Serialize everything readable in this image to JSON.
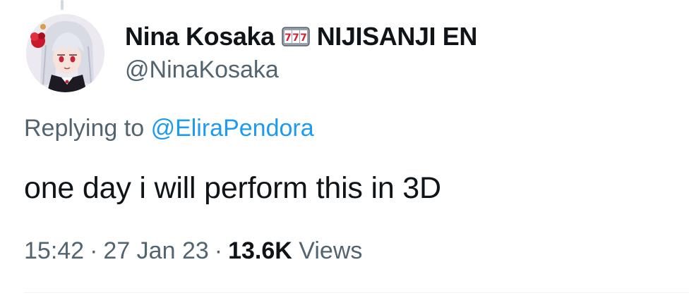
{
  "author": {
    "display_name": "Nina Kosaka",
    "badge_emoji": "slot-machine-icon",
    "affiliation": "NIJISANJI EN",
    "handle": "@NinaKosaka"
  },
  "reply": {
    "prefix": "Replying to",
    "mention": "@EliraPendora"
  },
  "tweet": {
    "text": "one day i will perform this in 3D"
  },
  "meta": {
    "time": "15:42",
    "separator": "·",
    "date": "27 Jan 23",
    "views_count": "13.6K",
    "views_label": "Views"
  },
  "colors": {
    "text_primary": "#0f1419",
    "text_secondary": "#536471",
    "link": "#1d9bf0"
  }
}
